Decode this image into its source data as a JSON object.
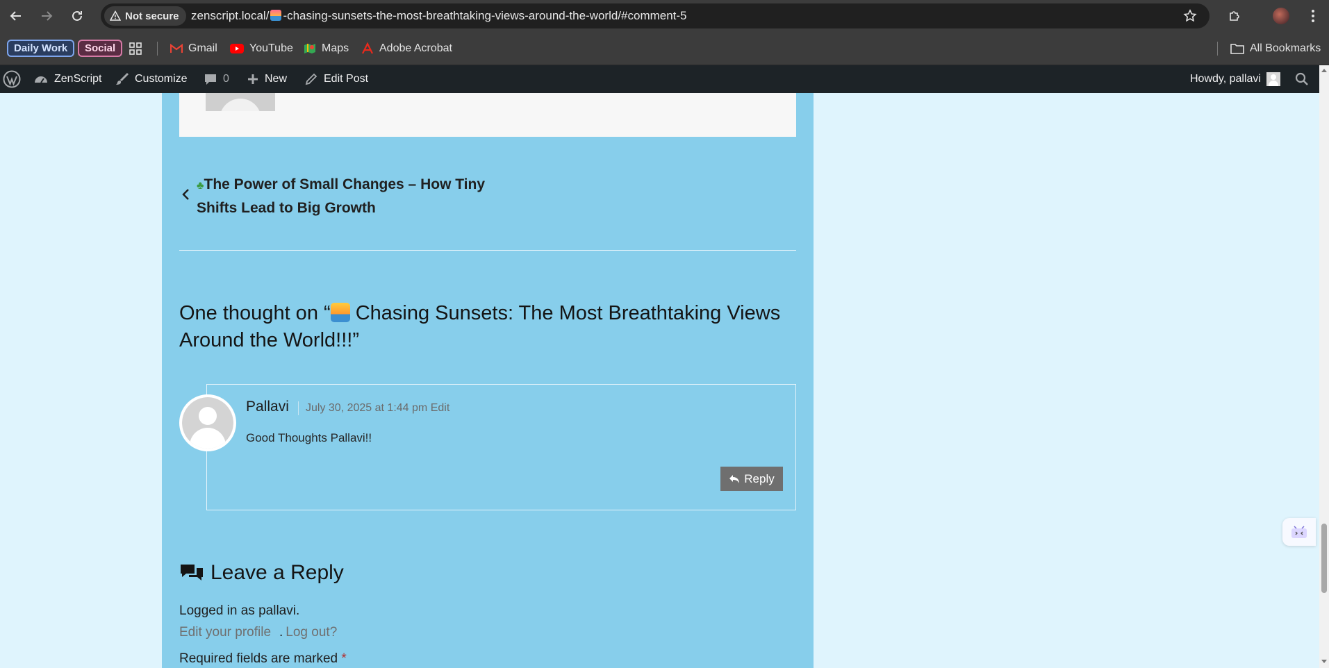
{
  "browser": {
    "security_label": "Not secure",
    "url_prefix": "zenscript.local/",
    "url_suffix": "-chasing-sunsets-the-most-breathtaking-views-around-the-world/#comment-5"
  },
  "bookmarks": {
    "groups": [
      "Daily Work",
      "Social"
    ],
    "items": [
      "Gmail",
      "YouTube",
      "Maps",
      "Adobe Acrobat"
    ],
    "all_bookmarks": "All Bookmarks"
  },
  "adminbar": {
    "site_name": "ZenScript",
    "customize": "Customize",
    "comments_count": "0",
    "new": "New",
    "edit_post": "Edit Post",
    "howdy": "Howdy, pallavi"
  },
  "post_nav": {
    "prev_title": "The Power of Small Changes – How Tiny Shifts Lead to Big Growth"
  },
  "comments": {
    "title_prefix": "One thought on “",
    "title_text": " Chasing Sunsets: The Most Breathtaking Views Around the World!!!”",
    "items": [
      {
        "author": "Pallavi",
        "date": "July 30, 2025 at 1:44 pm",
        "edit": "Edit",
        "text": "Good Thoughts Pallavi!!",
        "reply": "Reply"
      }
    ]
  },
  "reply_form": {
    "title": "Leave a Reply",
    "logged_in": "Logged in as pallavi.",
    "edit_profile": "Edit your profile",
    "separator": ".",
    "logout": "Log out?",
    "required_text": "Required fields are marked",
    "required_star": "*"
  },
  "colors": {
    "page_bg": "#dff4fd",
    "content_bg": "#87ceeb",
    "adminbar_bg": "#1d2327",
    "reply_button": "#6f6f6f"
  }
}
